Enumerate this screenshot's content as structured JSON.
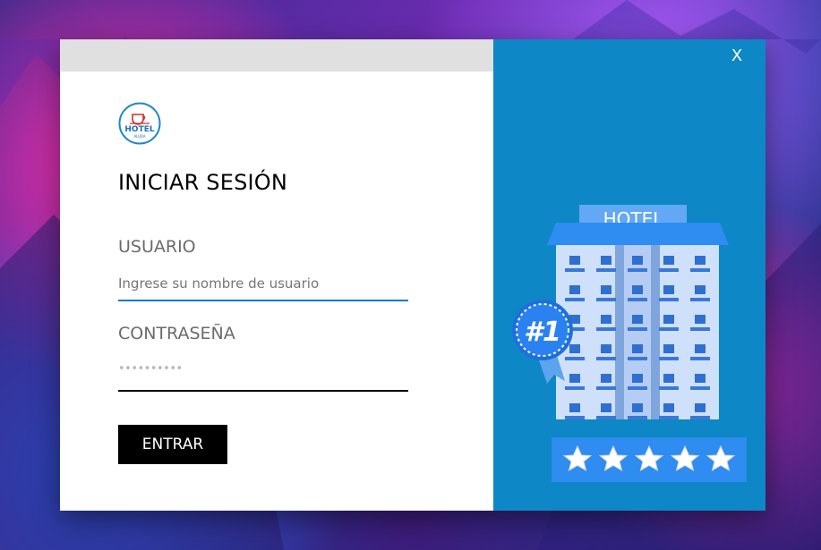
{
  "window": {
    "close_label": "X"
  },
  "logo": {
    "text_main": "HOTEL",
    "text_sub": "ALURA"
  },
  "login": {
    "title": "INICIAR SESIÓN",
    "username_label": "USUARIO",
    "username_placeholder": "Ingrese su nombre de usuario",
    "password_label": "CONTRASEÑA",
    "password_value": "••••••••••",
    "submit_label": "ENTRAR"
  },
  "illustration": {
    "sign_text": "HOTEL",
    "badge_text": "#1",
    "stars": 5
  },
  "colors": {
    "accent_blue": "#0e87c7",
    "username_underline": "#1a73e8",
    "password_underline": "#000000",
    "button_bg": "#000000"
  }
}
